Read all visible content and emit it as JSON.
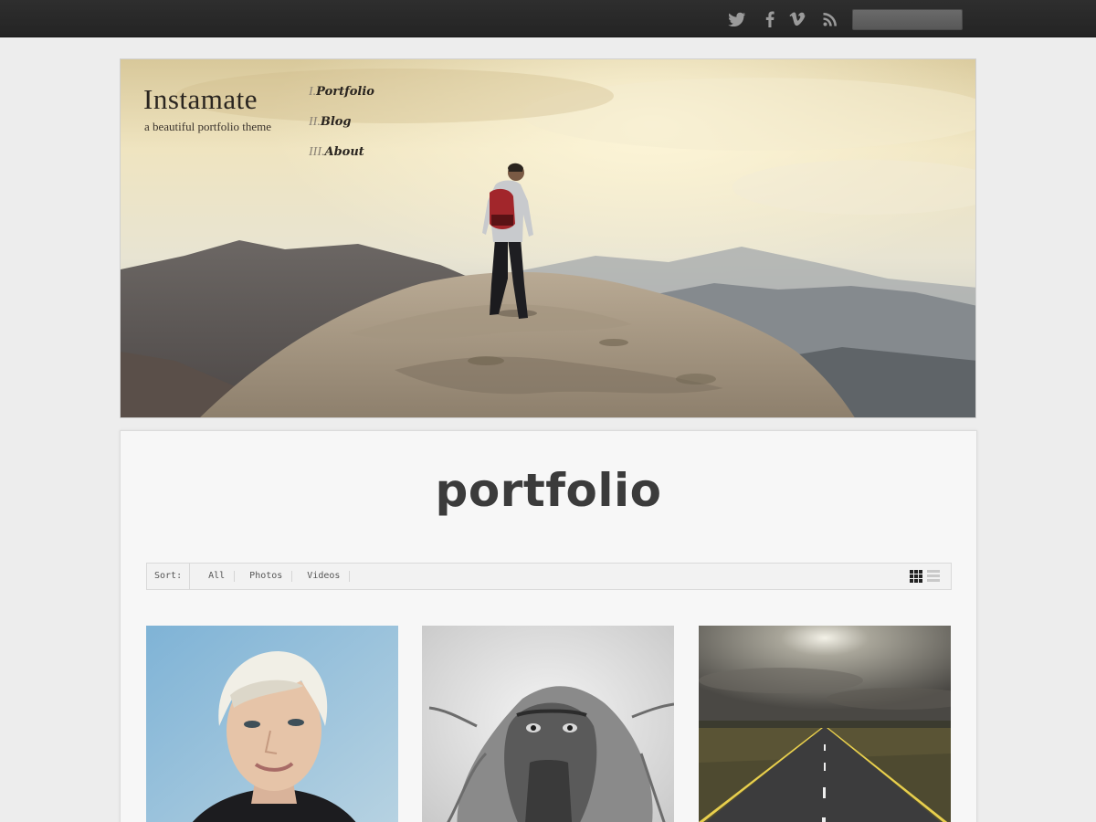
{
  "topbar": {
    "social_icons": [
      "twitter-icon",
      "facebook-icon",
      "vimeo-icon",
      "rss-icon"
    ],
    "search_value": ""
  },
  "header": {
    "site_title": "Instamate",
    "tagline": "a beautiful portfolio theme",
    "nav": [
      {
        "num": "I.",
        "label": "Portfolio"
      },
      {
        "num": "II.",
        "label": "Blog"
      },
      {
        "num": "III.",
        "label": "About"
      }
    ]
  },
  "main": {
    "title": "portfolio",
    "sort": {
      "label": "Sort:",
      "options": [
        "All",
        "Photos",
        "Videos"
      ],
      "view_icons": [
        "grid-view-icon",
        "list-view-icon"
      ]
    },
    "thumbnails": [
      "portrait-photo",
      "baboon-photo",
      "road-photo"
    ]
  },
  "colors": {
    "topbar": "#282828",
    "background": "#ededed",
    "panel": "#f7f7f7",
    "title_text": "#3b3b3b"
  }
}
